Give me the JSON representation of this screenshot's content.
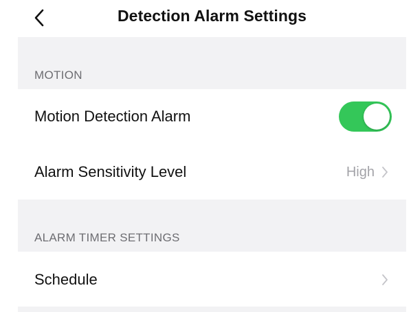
{
  "header": {
    "title": "Detection Alarm Settings",
    "back_icon": "chevron-left-icon"
  },
  "sections": [
    {
      "title": "MOTION",
      "rows": [
        {
          "label": "Motion Detection Alarm",
          "control": "toggle",
          "toggle_on": true
        },
        {
          "label": "Alarm Sensitivity Level",
          "value": "High",
          "control": "chevron"
        }
      ]
    },
    {
      "title": "ALARM TIMER SETTINGS",
      "rows": [
        {
          "label": "Schedule",
          "value": "",
          "control": "chevron"
        }
      ]
    }
  ],
  "colors": {
    "accent_toggle": "#34c759",
    "section_background": "#f2f2f4",
    "secondary_text": "#a3a3a8"
  }
}
